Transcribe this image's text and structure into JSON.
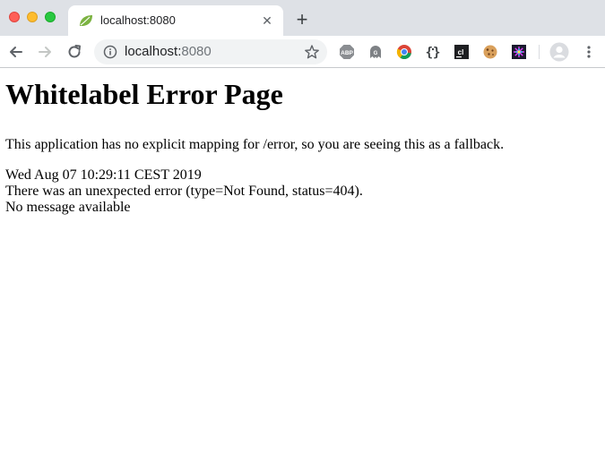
{
  "browser": {
    "tab": {
      "title": "localhost:8080",
      "close_glyph": "✕",
      "favicon": "spring-leaf-icon"
    },
    "new_tab_glyph": "+",
    "address_bar": {
      "host": "localhost:",
      "port": "8080"
    },
    "extensions": [
      "abp-icon",
      "ghostery-icon",
      "chrome-extension-icon",
      "json-viewer-icon",
      "clion-icon",
      "cookie-icon",
      "colorful-extension-icon"
    ],
    "colors": {
      "tabstrip_bg": "#dee1e6",
      "omnibox_bg": "#f1f3f4",
      "traffic_close": "#fe5f57",
      "traffic_minimize": "#febc2e",
      "traffic_maximize": "#28c840"
    }
  },
  "page": {
    "heading": "Whitelabel Error Page",
    "description": "This application has no explicit mapping for /error, so you are seeing this as a fallback.",
    "timestamp": "Wed Aug 07 10:29:11 CEST 2019",
    "error_line": "There was an unexpected error (type=Not Found, status=404).",
    "message": "No message available"
  }
}
